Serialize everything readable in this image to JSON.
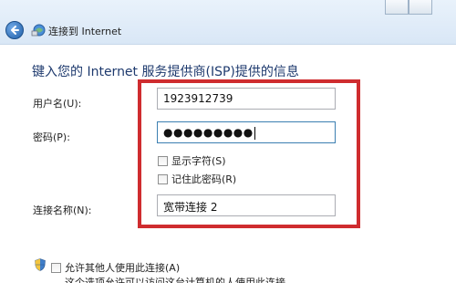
{
  "titlebar": {
    "title": "连接到 Internet"
  },
  "page": {
    "header": "键入您的 Internet 服务提供商(ISP)提供的信息"
  },
  "form": {
    "username_label": "用户名(U):",
    "username_value": "1923912739",
    "password_label": "密码(P):",
    "password_dots": "●●●●●●●●●",
    "show_chars_label": "显示字符(S)",
    "remember_password_label": "记住此密码(R)",
    "connection_name_label": "连接名称(N):",
    "connection_name_value": "宽带连接 2"
  },
  "sharing": {
    "allow_others_label": "允许其他人使用此连接(A)",
    "note": "这个选项允许可以访问这台计算机的人使用此连接。"
  },
  "colors": {
    "highlight": "#cf2c2f",
    "header_text": "#1e3a6e"
  },
  "icons": {
    "back": "back-arrow-icon",
    "network": "network-connection-icon",
    "shield": "uac-shield-icon"
  }
}
